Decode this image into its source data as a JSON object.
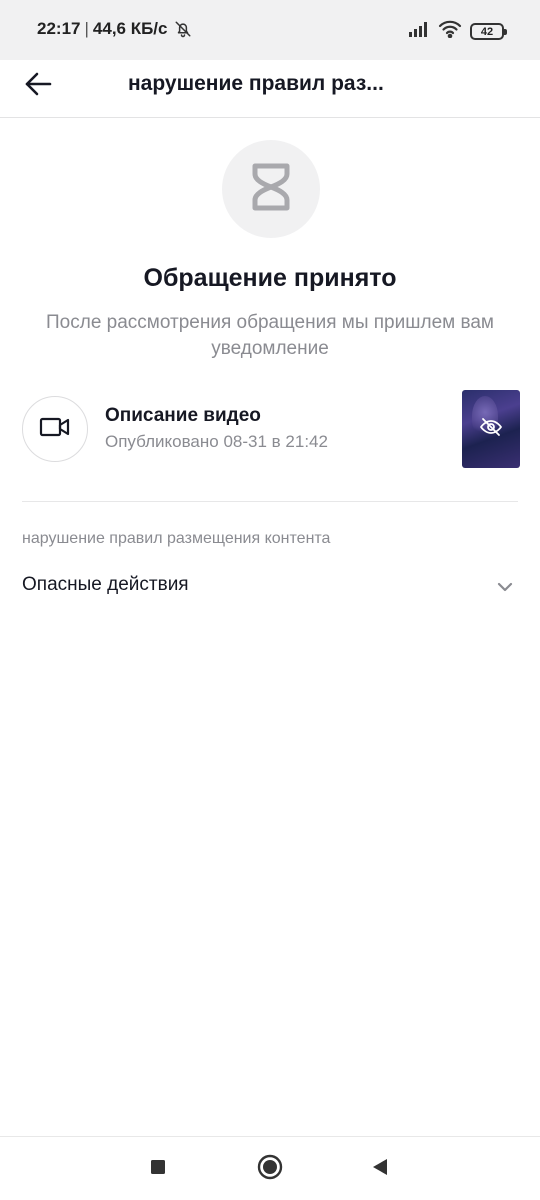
{
  "status_bar": {
    "time": "22:17",
    "separator": "|",
    "net_speed": "44,6 КБ/с",
    "battery": "42",
    "icons": [
      "bell-off-icon",
      "signal-icon",
      "wifi-icon",
      "battery-icon"
    ]
  },
  "app_bar": {
    "title": "нарушение правил раз..."
  },
  "status": {
    "title": "Обращение принято",
    "description": "После рассмотрения обращения мы пришлем вам уведомление"
  },
  "video": {
    "title": "Описание видео",
    "published": "Опубликовано 08-31 в 21:42"
  },
  "violation": {
    "section_label": "нарушение правил размещения контента",
    "reason": "Опасные действия"
  },
  "colors": {
    "primary_text": "#161823",
    "secondary_text": "#8a8b91",
    "icon_bg": "#f1f1f2"
  }
}
